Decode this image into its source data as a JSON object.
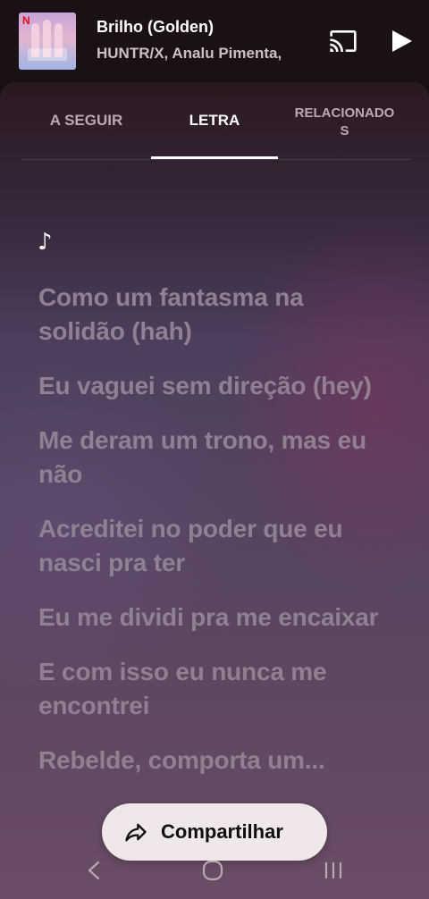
{
  "miniplayer": {
    "title": "Brilho (Golden)",
    "artist": "HUNTR/X, Analu Pimenta,",
    "album_badge": "N",
    "cast_icon": "cast-icon",
    "play_icon": "play-icon"
  },
  "tabs": [
    {
      "label": "A SEGUIR",
      "active": false
    },
    {
      "label": "LETRA",
      "active": true
    },
    {
      "label": "RELACIONADOS",
      "active": false
    }
  ],
  "lyrics": {
    "note": "♪",
    "lines": [
      "Como um fantasma na solidão (hah)",
      "Eu vaguei sem direção (hey)",
      "Me deram um trono, mas eu não",
      "Acreditei no poder que eu nasci pra ter",
      "Eu me dividi pra me encaixar",
      "E com isso eu nunca me encontrei",
      "Rebelde, comporta um..."
    ]
  },
  "share": {
    "label": "Compartilhar",
    "icon": "share-arrow-icon"
  },
  "navbar": {
    "back_icon": "back-chevron-icon",
    "home_icon": "home-circle-icon",
    "recents_icon": "recents-bars-icon"
  },
  "colors": {
    "background": "#1a1015",
    "lyrics_text": "#908092",
    "active_tab": "#ffffff",
    "share_button": "#efe7ea"
  }
}
